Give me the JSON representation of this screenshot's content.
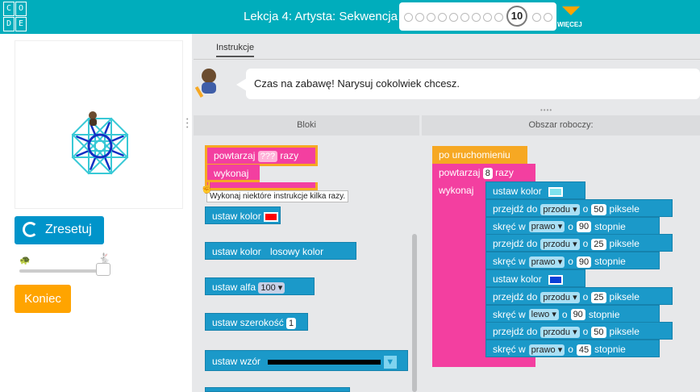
{
  "header": {
    "logo_letters": [
      "C",
      "O",
      "D",
      "E"
    ],
    "lesson_title": "Lekcja 4: Artysta: Sekwencja",
    "current_level": "10",
    "more_label": "WIĘCEJ"
  },
  "left_panel": {
    "reset_label": "Zresetuj",
    "finish_label": "Koniec",
    "speed_slider_value": 1.0
  },
  "instructions": {
    "tab_label": "Instrukcje",
    "text": "Czas na zabawę! Narysuj cokolwiek chcesz."
  },
  "panels": {
    "blocks_header": "Bloki",
    "workspace_header": "Obszar roboczy:"
  },
  "toolbox": {
    "repeat_label": "powtarzaj",
    "repeat_value": "???",
    "repeat_suffix": "razy",
    "do_label": "wykonaj",
    "tooltip": "Wykonaj niektóre instrukcje kilka razy.",
    "set_color_label": "ustaw kolor",
    "set_color_swatch": "#ff0000",
    "set_color_random_label": "ustaw kolor",
    "random_color_label": "losowy kolor",
    "set_alpha_label": "ustaw alfa",
    "alpha_value": "100",
    "set_width_label": "ustaw szerokość",
    "width_value": "1",
    "set_pattern_label": "ustaw wzór"
  },
  "workspace": {
    "when_run_label": "po uruchomieniu",
    "repeat_label": "powtarzaj",
    "repeat_value": "8",
    "repeat_suffix": "razy",
    "do_label": "wykonaj",
    "blocks": [
      {
        "type": "color",
        "label": "ustaw kolor",
        "color": "#7fe3ee"
      },
      {
        "type": "move",
        "label": "przejdź do",
        "dir": "przodu",
        "o": "o",
        "value": "50",
        "unit": "piksele"
      },
      {
        "type": "turn",
        "label": "skręć w",
        "dir": "prawo",
        "o": "o",
        "value": "90",
        "unit": "stopnie"
      },
      {
        "type": "move",
        "label": "przejdź do",
        "dir": "przodu",
        "o": "o",
        "value": "25",
        "unit": "piksele"
      },
      {
        "type": "turn",
        "label": "skręć w",
        "dir": "prawo",
        "o": "o",
        "value": "90",
        "unit": "stopnie"
      },
      {
        "type": "color",
        "label": "ustaw kolor",
        "color": "#0b3fd6"
      },
      {
        "type": "move",
        "label": "przejdź do",
        "dir": "przodu",
        "o": "o",
        "value": "25",
        "unit": "piksele"
      },
      {
        "type": "turn",
        "label": "skręć w",
        "dir": "lewo",
        "o": "o",
        "value": "90",
        "unit": "stopnie"
      },
      {
        "type": "move",
        "label": "przejdź do",
        "dir": "przodu",
        "o": "o",
        "value": "50",
        "unit": "piksele"
      },
      {
        "type": "turn",
        "label": "skręć w",
        "dir": "prawo",
        "o": "o",
        "value": "45",
        "unit": "stopnie"
      }
    ]
  },
  "colors": {
    "header": "#00adbc",
    "accent_orange": "#ffa400",
    "block_teal": "#1b99c9",
    "block_pink": "#f33fa0",
    "block_orange": "#f6a823",
    "drawing_cyan": "#39c9d6",
    "drawing_blue": "#1230c4"
  }
}
